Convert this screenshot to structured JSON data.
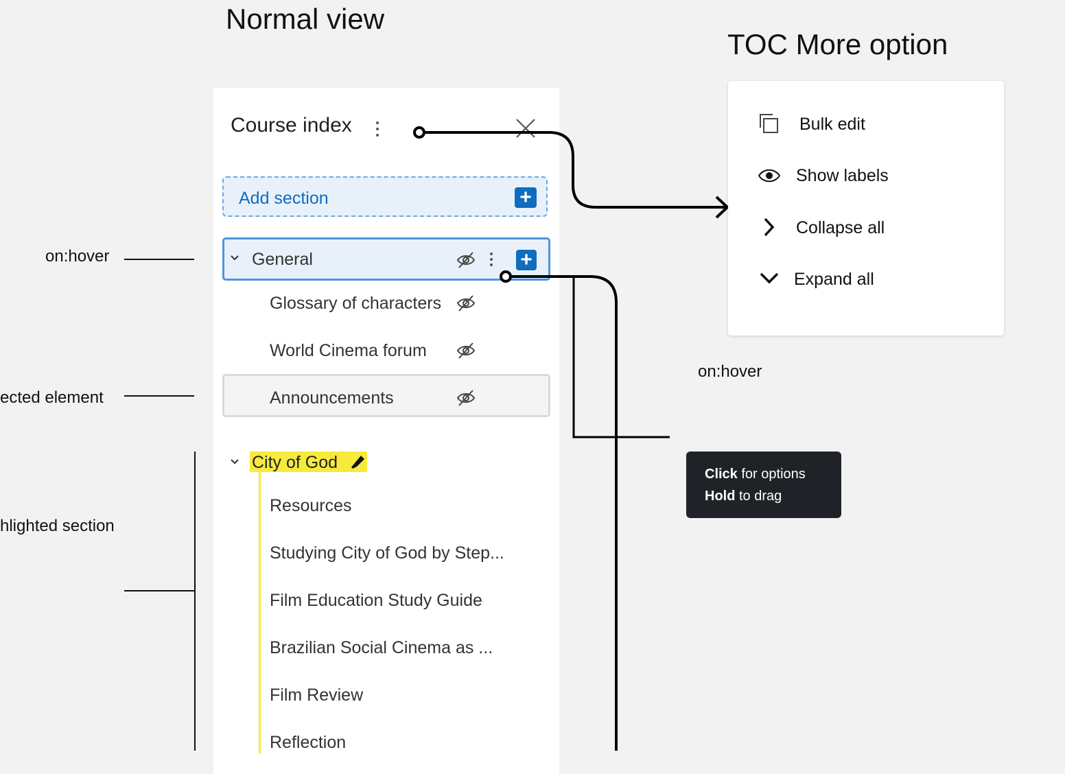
{
  "headings": {
    "normal_view": "Normal view",
    "toc_more_option": "TOC More option"
  },
  "annotations": {
    "hover_left": "on:hover",
    "selected_element": "ected element",
    "highlighted_section": "hlighted section",
    "hover_right": "on:hover"
  },
  "panel": {
    "title": "Course index",
    "add_section_label": "Add section",
    "sections": [
      {
        "title": "General",
        "items": [
          "Glossary of characters",
          "World Cinema forum",
          "Announcements"
        ]
      },
      {
        "title": "City of God",
        "items": [
          "Resources",
          "Studying City of God by Step...",
          "Film Education Study Guide",
          "Brazilian Social Cinema as  ...",
          "Film Review",
          "Reflection"
        ]
      }
    ]
  },
  "toc_menu": {
    "items": [
      {
        "label": "Bulk edit",
        "icon": "copy-icon"
      },
      {
        "label": "Show labels",
        "icon": "eye-icon"
      },
      {
        "label": "Collapse all",
        "icon": "chevron-right-icon"
      },
      {
        "label": "Expand all",
        "icon": "chevron-down-icon"
      }
    ]
  },
  "tooltip": {
    "line1_bold": "Click",
    "line1_rest": " for options",
    "line2_bold": "Hold",
    "line2_rest": " to drag"
  },
  "colors": {
    "accent": "#0f6cbf",
    "highlight": "#f7ea3b",
    "hover_bg": "#e8f1fa",
    "tooltip_bg": "#1f2327"
  }
}
